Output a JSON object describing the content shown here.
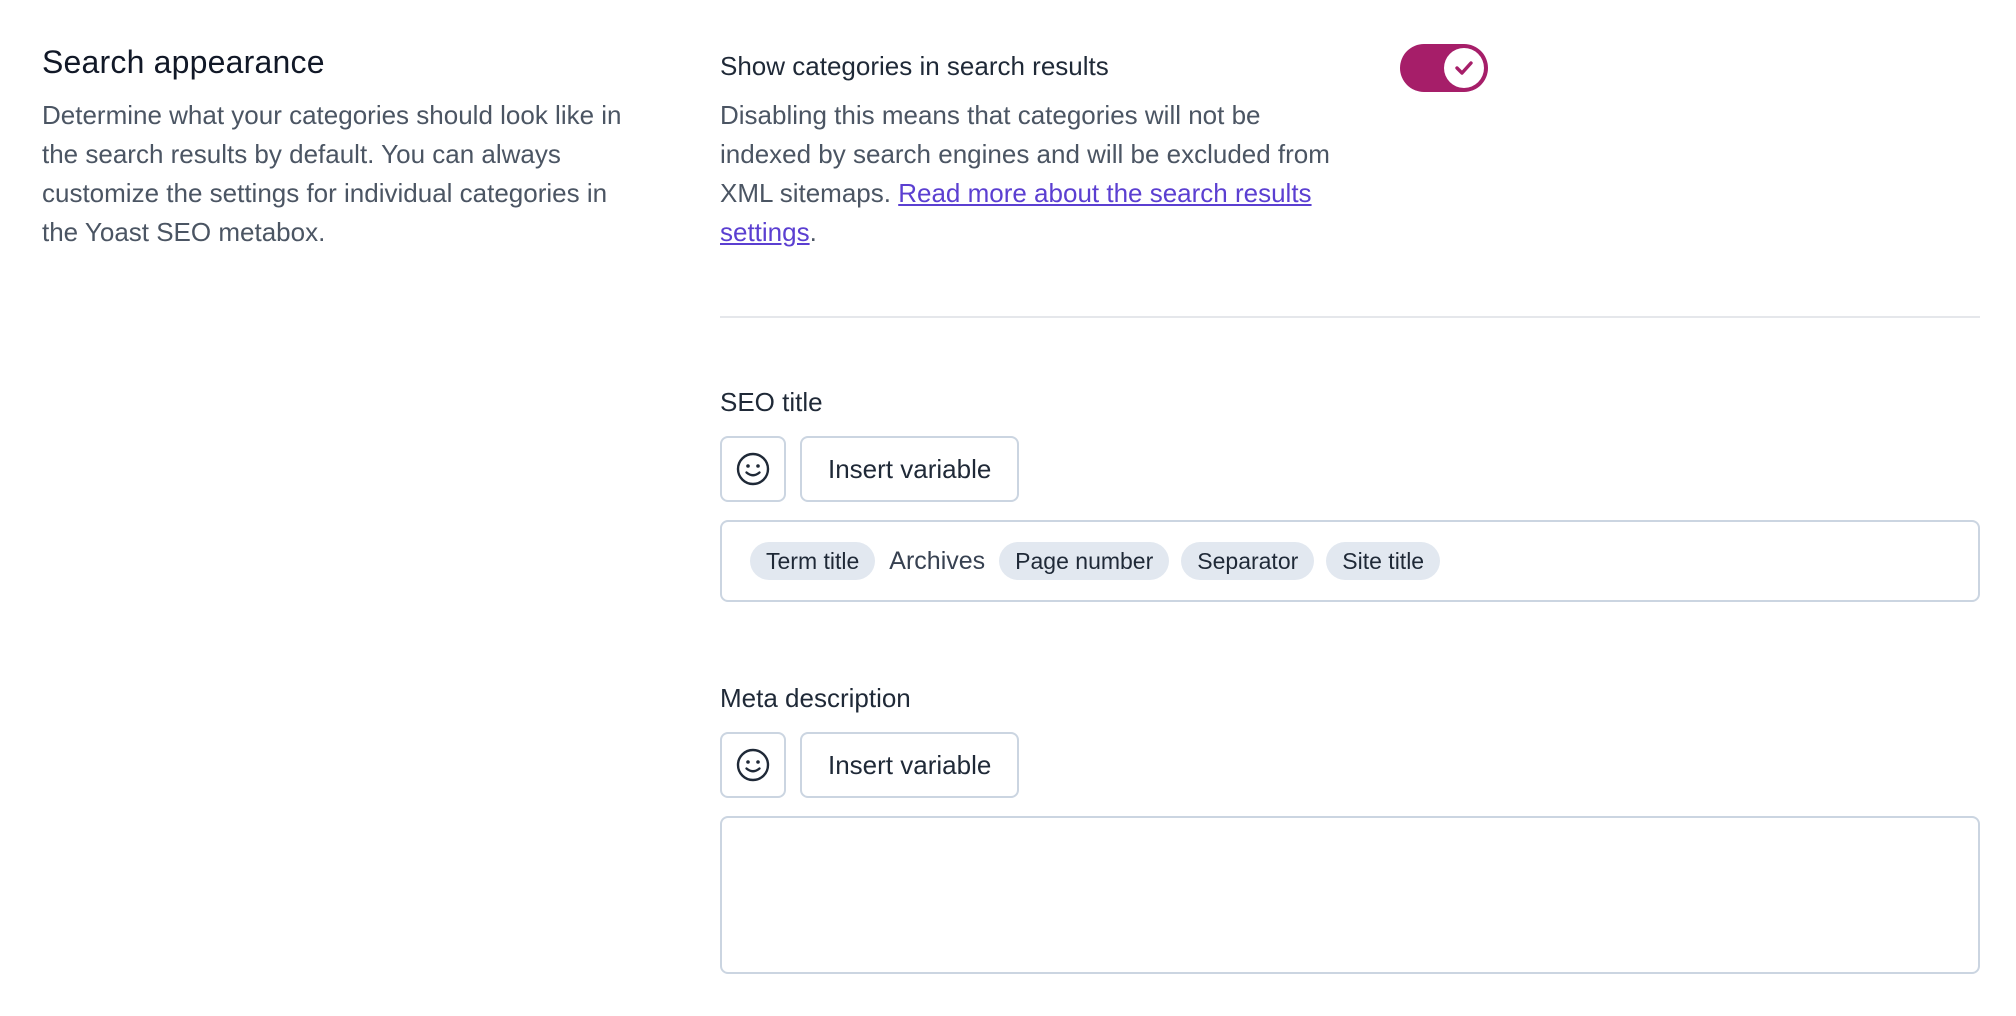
{
  "section": {
    "title": "Search appearance",
    "description": "Determine what your categories should look like in the search results by default. You can always customize the settings for individual categories in the Yoast SEO metabox."
  },
  "toggle": {
    "label": "Show categories in search results",
    "checked": true,
    "accent_color": "#a61e69",
    "icon": "check-icon",
    "description_prefix": "Disabling this means that categories will not be indexed by search engines and will be excluded from XML sitemaps. ",
    "link_text": "Read more about the search results settings",
    "description_suffix": "."
  },
  "seo_title": {
    "label": "SEO title",
    "emoji_icon": "smiley-icon",
    "insert_variable_label": "Insert variable",
    "tokens": [
      {
        "type": "variable",
        "text": "Term title"
      },
      {
        "type": "text",
        "text": "Archives"
      },
      {
        "type": "variable",
        "text": "Page number"
      },
      {
        "type": "variable",
        "text": "Separator"
      },
      {
        "type": "variable",
        "text": "Site title"
      }
    ]
  },
  "meta_description": {
    "label": "Meta description",
    "emoji_icon": "smiley-icon",
    "insert_variable_label": "Insert variable",
    "value": ""
  }
}
